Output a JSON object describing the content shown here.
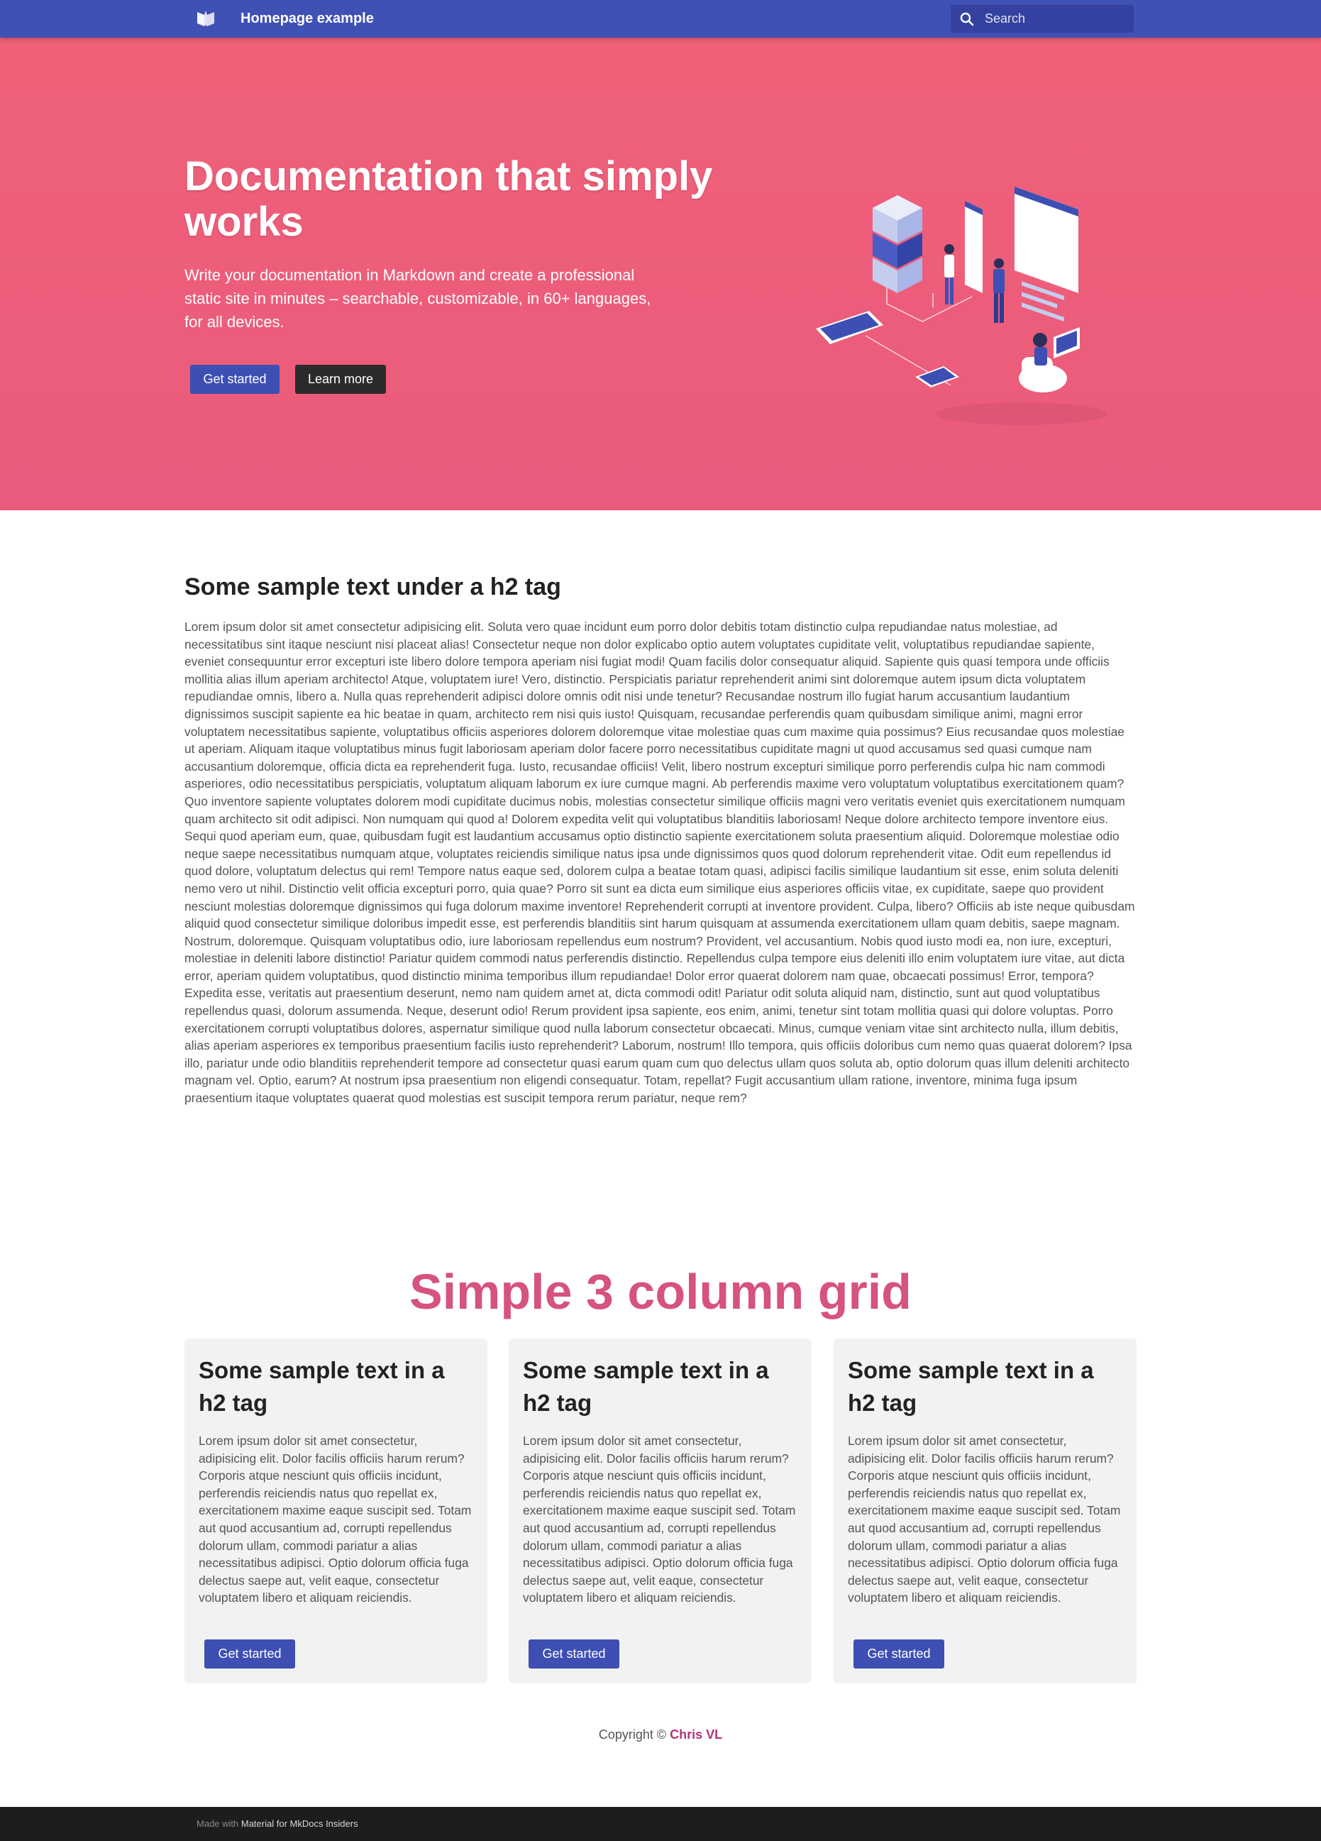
{
  "header": {
    "site_title": "Homepage example",
    "search_placeholder": "Search",
    "logo_icon": "book-open-icon",
    "search_icon": "magnify-icon"
  },
  "hero": {
    "title": "Documentation that simply works",
    "text": "Write your documentation in Markdown and create a professional static site in minutes – searchable, customizable, in 60+ languages, for all devices.",
    "primary_button": "Get started",
    "secondary_button": "Learn more"
  },
  "sample": {
    "heading": "Some sample text under a h2 tag",
    "body": "Lorem ipsum dolor sit amet consectetur adipisicing elit. Soluta vero quae incidunt eum porro dolor debitis totam distinctio culpa repudiandae natus molestiae, ad necessitatibus sint itaque nesciunt nisi placeat alias! Consectetur neque non dolor explicabo optio autem voluptates cupiditate velit, voluptatibus repudiandae sapiente, eveniet consequuntur error excepturi iste libero dolore tempora aperiam nisi fugiat modi! Quam facilis dolor consequatur aliquid. Sapiente quis quasi tempora unde officiis mollitia alias illum aperiam architecto! Atque, voluptatem iure! Vero, distinctio. Perspiciatis pariatur reprehenderit animi sint doloremque autem ipsum dicta voluptatem repudiandae omnis, libero a. Nulla quas reprehenderit adipisci dolore omnis odit nisi unde tenetur? Recusandae nostrum illo fugiat harum accusantium laudantium dignissimos suscipit sapiente ea hic beatae in quam, architecto rem nisi quis iusto! Quisquam, recusandae perferendis quam quibusdam similique animi, magni error voluptatem necessitatibus sapiente, voluptatibus officiis asperiores dolorem doloremque vitae molestiae quas cum maxime quia possimus? Eius recusandae quos molestiae ut aperiam. Aliquam itaque voluptatibus minus fugit laboriosam aperiam dolor facere porro necessitatibus cupiditate magni ut quod accusamus sed quasi cumque nam accusantium doloremque, officia dicta ea reprehenderit fuga. Iusto, recusandae officiis! Velit, libero nostrum excepturi similique porro perferendis culpa hic nam commodi asperiores, odio necessitatibus perspiciatis, voluptatum aliquam laborum ex iure cumque magni. Ab perferendis maxime vero voluptatum voluptatibus exercitationem quam? Quo inventore sapiente voluptates dolorem modi cupiditate ducimus nobis, molestias consectetur similique officiis magni vero veritatis eveniet quis exercitationem numquam quam architecto sit odit adipisci. Non numquam qui quod a! Dolorem expedita velit qui voluptatibus blanditiis laboriosam! Neque dolore architecto tempore inventore eius. Sequi quod aperiam eum, quae, quibusdam fugit est laudantium accusamus optio distinctio sapiente exercitationem soluta praesentium aliquid. Doloremque molestiae odio neque saepe necessitatibus numquam atque, voluptates reiciendis similique natus ipsa unde dignissimos quos quod dolorum reprehenderit vitae. Odit eum repellendus id quod dolore, voluptatum delectus qui rem! Tempore natus eaque sed, dolorem culpa a beatae totam quasi, adipisci facilis similique laudantium sit esse, enim soluta deleniti nemo vero ut nihil. Distinctio velit officia excepturi porro, quia quae? Porro sit sunt ea dicta eum similique eius asperiores officiis vitae, ex cupiditate, saepe quo provident nesciunt molestias doloremque dignissimos qui fuga dolorum maxime inventore! Reprehenderit corrupti at inventore provident. Culpa, libero? Officiis ab iste neque quibusdam aliquid quod consectetur similique doloribus impedit esse, est perferendis blanditiis sint harum quisquam at assumenda exercitationem ullam quam debitis, saepe magnam. Nostrum, doloremque. Quisquam voluptatibus odio, iure laboriosam repellendus eum nostrum? Provident, vel accusantium. Nobis quod iusto modi ea, non iure, excepturi, molestiae in deleniti labore distinctio! Pariatur quidem commodi natus perferendis distinctio. Repellendus culpa tempore eius deleniti illo enim voluptatem iure vitae, aut dicta error, aperiam quidem voluptatibus, quod distinctio minima temporibus illum repudiandae! Dolor error quaerat dolorem nam quae, obcaecati possimus! Error, tempora? Expedita esse, veritatis aut praesentium deserunt, nemo nam quidem amet at, dicta commodi odit! Pariatur odit soluta aliquid nam, distinctio, sunt aut quod voluptatibus repellendus quasi, dolorum assumenda. Neque, deserunt odio! Rerum provident ipsa sapiente, eos enim, animi, tenetur sint totam mollitia quasi qui dolore voluptas. Porro exercitationem corrupti voluptatibus dolores, aspernatur similique quod nulla laborum consectetur obcaecati. Minus, cumque veniam vitae sint architecto nulla, illum debitis, alias aperiam asperiores ex temporibus praesentium facilis iusto reprehenderit? Laborum, nostrum! Illo tempora, quis officiis doloribus cum nemo quas quaerat dolorem? Ipsa illo, pariatur unde odio blanditiis reprehenderit tempore ad consectetur quasi earum quam cum quo delectus ullam quos soluta ab, optio dolorum quas illum deleniti architecto magnam vel. Optio, earum? At nostrum ipsa praesentium non eligendi consequatur. Totam, repellat? Fugit accusantium ullam ratione, inventore, minima fuga ipsum praesentium itaque voluptates quaerat quod molestias est suscipit tempora rerum pariatur, neque rem?"
  },
  "grid": {
    "title": "Simple 3 column grid",
    "cards": [
      {
        "heading": "Some sample text in a h2 tag",
        "body": "Lorem ipsum dolor sit amet consectetur, adipisicing elit. Dolor facilis officiis harum rerum? Corporis atque nesciunt quis officiis incidunt, perferendis reiciendis natus quo repellat ex, exercitationem maxime eaque suscipit sed. Totam aut quod accusantium ad, corrupti repellendus dolorum ullam, commodi pariatur a alias necessitatibus adipisci. Optio dolorum officia fuga delectus saepe aut, velit eaque, consectetur voluptatem libero et aliquam reiciendis.",
        "button": "Get started"
      },
      {
        "heading": "Some sample text in a h2 tag",
        "body": "Lorem ipsum dolor sit amet consectetur, adipisicing elit. Dolor facilis officiis harum rerum? Corporis atque nesciunt quis officiis incidunt, perferendis reiciendis natus quo repellat ex, exercitationem maxime eaque suscipit sed. Totam aut quod accusantium ad, corrupti repellendus dolorum ullam, commodi pariatur a alias necessitatibus adipisci. Optio dolorum officia fuga delectus saepe aut, velit eaque, consectetur voluptatem libero et aliquam reiciendis.",
        "button": "Get started"
      },
      {
        "heading": "Some sample text in a h2 tag",
        "body": "Lorem ipsum dolor sit amet consectetur, adipisicing elit. Dolor facilis officiis harum rerum? Corporis atque nesciunt quis officiis incidunt, perferendis reiciendis natus quo repellat ex, exercitationem maxime eaque suscipit sed. Totam aut quod accusantium ad, corrupti repellendus dolorum ullam, commodi pariatur a alias necessitatibus adipisci. Optio dolorum officia fuga delectus saepe aut, velit eaque, consectetur voluptatem libero et aliquam reiciendis.",
        "button": "Get started"
      }
    ]
  },
  "copyright": {
    "prefix": "Copyright ©",
    "author": "Chris VL"
  },
  "footer": {
    "made_with": "Made with",
    "link": "Material for MkDocs Insiders"
  },
  "colors": {
    "header": "#4051b5",
    "hero": "#f06179",
    "grid_title": "#d6527f",
    "button": "#3d4fb3",
    "footer": "#1d1d1f"
  }
}
